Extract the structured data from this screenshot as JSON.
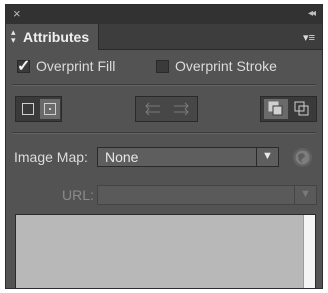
{
  "titlebar": {
    "close_glyph": "×",
    "collapse_glyph": "◂◂"
  },
  "tab": {
    "label": "Attributes",
    "arrows_icon": "up-down-arrows-icon",
    "menu_glyph": "▾≡"
  },
  "checkboxes": {
    "overprint_fill": {
      "label": "Overprint Fill",
      "checked": true
    },
    "overprint_stroke": {
      "label": "Overprint Stroke",
      "checked": false
    }
  },
  "image_map": {
    "label": "Image Map:",
    "value": "None",
    "arrow": "▼"
  },
  "url": {
    "label": "URL:",
    "value": "",
    "arrow": "▼"
  },
  "colors": {
    "panel_bg": "#535353",
    "titlebar_bg": "#323232",
    "preview_bg": "#b8b8b8"
  }
}
